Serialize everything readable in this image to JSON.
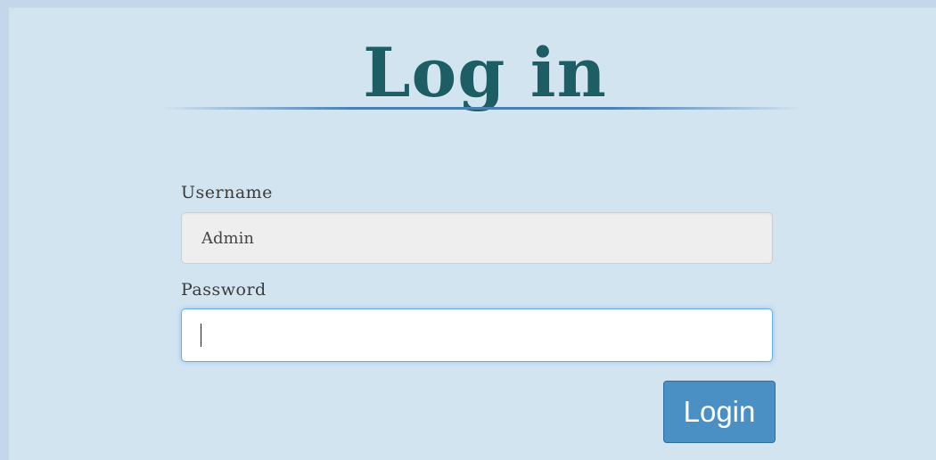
{
  "page": {
    "title": "Log in"
  },
  "form": {
    "username": {
      "label": "Username",
      "value": "Admin"
    },
    "password": {
      "label": "Password",
      "value": ""
    },
    "submit_label": "Login"
  }
}
